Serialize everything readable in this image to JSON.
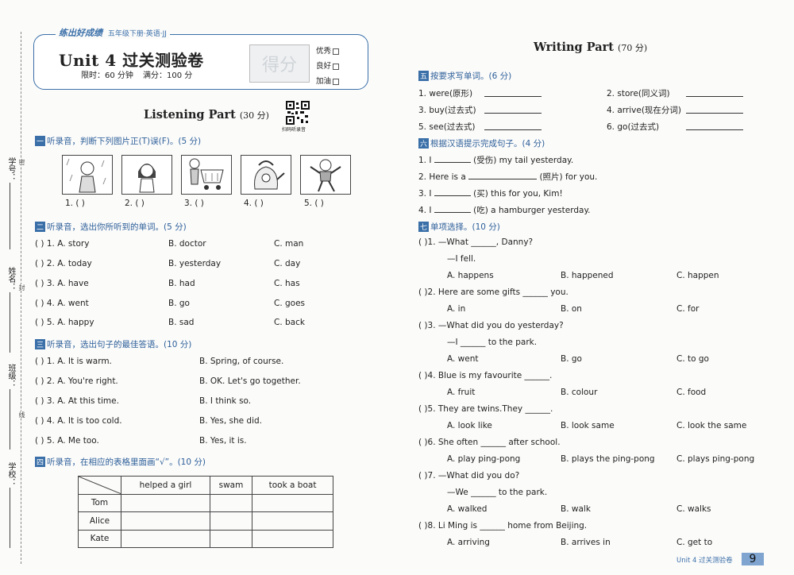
{
  "margin": {
    "labels": [
      "学号：",
      "姓名：",
      "班级：",
      "学校："
    ],
    "cut_marks": [
      "密",
      "封",
      "线"
    ]
  },
  "header": {
    "brand": "练出好成绩",
    "series": "五年级下册·英语·JJ",
    "title": "Unit 4 过关测验卷",
    "time": "限时：60 分钟",
    "score": "满分：100 分",
    "score_box": "得分",
    "grades": [
      "优秀",
      "良好",
      "加油"
    ]
  },
  "listening": {
    "title": "Listening Part",
    "points": "(30 分)",
    "qr_caption": "扫码听录音",
    "s1": {
      "num": "一",
      "title": "听录音，判断下列图片正(T)误(F)。(5 分)",
      "items": [
        "1. (      )",
        "2. (      )",
        "3. (      )",
        "4. (      )",
        "5. (      )"
      ],
      "pic_icons": [
        "child-rain-icon",
        "girl-icon",
        "shopping-cart-icon",
        "kettle-icon",
        "boy-icon"
      ]
    },
    "s2": {
      "num": "二",
      "title": "听录音，选出你所听到的单词。(5 分)",
      "rows": [
        {
          "q": "(    ) 1. A. story",
          "b": "B. doctor",
          "c": "C. man"
        },
        {
          "q": "(    ) 2. A. today",
          "b": "B. yesterday",
          "c": "C. day"
        },
        {
          "q": "(    ) 3. A. have",
          "b": "B. had",
          "c": "C. has"
        },
        {
          "q": "(    ) 4. A. went",
          "b": "B. go",
          "c": "C. goes"
        },
        {
          "q": "(    ) 5. A. happy",
          "b": "B. sad",
          "c": "C. back"
        }
      ]
    },
    "s3": {
      "num": "三",
      "title": "听录音，选出句子的最佳答语。(10 分)",
      "rows": [
        {
          "q": "(    ) 1. A. It is warm.",
          "b": "B. Spring, of course."
        },
        {
          "q": "(    ) 2. A. You're right.",
          "b": "B. OK. Let's go together."
        },
        {
          "q": "(    ) 3. A. At this time.",
          "b": "B. I think so."
        },
        {
          "q": "(    ) 4. A. It is too cold.",
          "b": "B. Yes, she did."
        },
        {
          "q": "(    ) 5. A. Me too.",
          "b": "B. Yes, it is."
        }
      ]
    },
    "s4": {
      "num": "四",
      "title": "听录音，在相应的表格里面画“√”。(10 分)",
      "columns": [
        "helped a girl",
        "swam",
        "took a boat"
      ],
      "rows": [
        "Tom",
        "Alice",
        "Kate"
      ]
    }
  },
  "writing": {
    "title": "Writing Part",
    "points": "(70 分)",
    "s5": {
      "num": "五",
      "title": "按要求写单词。(6 分)",
      "items": [
        "1. were(原形)",
        "2. store(同义词)",
        "3. buy(过去式)",
        "4. arrive(现在分词)",
        "5. see(过去式)",
        "6. go(过去式)"
      ]
    },
    "s6": {
      "num": "六",
      "title": "根据汉语提示完成句子。(4 分)",
      "items": [
        {
          "a": "1. I",
          "b": "(受伤) my tail yesterday."
        },
        {
          "a": "2. Here is a",
          "b": "(照片) for you."
        },
        {
          "a": "3. I",
          "b": "(买) this for you, Kim!"
        },
        {
          "a": "4. I",
          "b": "(吃) a hamburger yesterday."
        }
      ]
    },
    "s7": {
      "num": "七",
      "title": "单项选择。(10 分)",
      "questions": [
        {
          "q": "(      )1. —What ______, Danny?",
          "extra": "—I fell.",
          "a": "A. happens",
          "b": "B. happened",
          "c": "C. happen"
        },
        {
          "q": "(      )2. Here are some gifts ______ you.",
          "extra": "",
          "a": "A. in",
          "b": "B. on",
          "c": "C. for"
        },
        {
          "q": "(      )3. —What did you do yesterday?",
          "extra": "—I ______ to the park.",
          "a": "A. went",
          "b": "B. go",
          "c": "C. to go"
        },
        {
          "q": "(      )4. Blue is my favourite ______.",
          "extra": "",
          "a": "A. fruit",
          "b": "B. colour",
          "c": "C. food"
        },
        {
          "q": "(      )5. They are twins.They ______.",
          "extra": "",
          "a": "A. look like",
          "b": "B. look same",
          "c": "C. look the same"
        },
        {
          "q": "(      )6. She often ______ after school.",
          "extra": "",
          "a": "A. play ping-pong",
          "b": "B. plays the ping-pong",
          "c": "C. plays ping-pong"
        },
        {
          "q": "(      )7. —What did you do?",
          "extra": "—We ______ to the park.",
          "a": "A. walked",
          "b": "B. walk",
          "c": "C. walks"
        },
        {
          "q": "(      )8. Li Ming is ______ home from Beijing.",
          "extra": "",
          "a": "A. arriving",
          "b": "B. arrives in",
          "c": "C. get to"
        }
      ]
    }
  },
  "footer": {
    "text": "Unit 4  过关测验卷",
    "page": "9"
  }
}
